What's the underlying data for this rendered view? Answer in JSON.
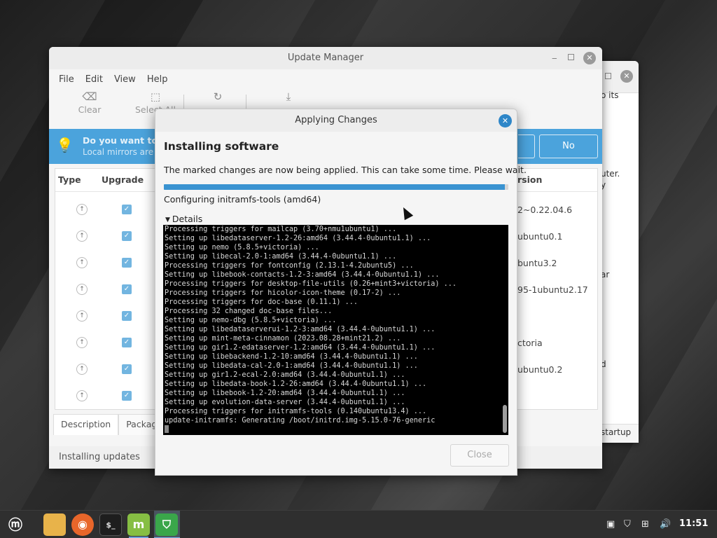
{
  "background_window": {
    "text_1": "o its",
    "text_2": "uter.",
    "text_3": "y",
    "text_4": "ar",
    "text_5": "d",
    "footer": "startup"
  },
  "update_manager": {
    "title": "Update Manager",
    "menu": [
      "File",
      "Edit",
      "View",
      "Help"
    ],
    "toolbar": {
      "clear": "Clear",
      "select_all": "Select All"
    },
    "infobar": {
      "title": "Do you want to s",
      "subtitle": "Local mirrors are",
      "no_label": "No"
    },
    "table": {
      "col_type": "Type",
      "col_upgrade": "Upgrade",
      "col_version": "rsion",
      "versions": [
        "2~0.22.04.6",
        "ubuntu0.1",
        "buntu3.2",
        "95-1ubuntu2.17",
        "",
        "ctoria",
        "ubuntu0.2",
        ""
      ]
    },
    "tabs": [
      "Description",
      "Packag"
    ],
    "status": "Installing updates"
  },
  "dialog": {
    "title": "Applying Changes",
    "heading": "Installing software",
    "message": "The marked changes are now being applied. This can take some time. Please wait.",
    "progress_fraction": 0.99,
    "status": "Configuring initramfs-tools (amd64)",
    "details_label": "Details",
    "close_label": "Close",
    "terminal_lines": [
      "Processing triggers for mailcap (3.70+nmu1ubuntu1) ...",
      "Setting up libedataserver-1.2-26:amd64 (3.44.4-0ubuntu1.1) ...",
      "Setting up nemo (5.8.5+victoria) ...",
      "Setting up libecal-2.0-1:amd64 (3.44.4-0ubuntu1.1) ...",
      "Processing triggers for fontconfig (2.13.1-4.2ubuntu5) ...",
      "Setting up libebook-contacts-1.2-3:amd64 (3.44.4-0ubuntu1.1) ...",
      "Processing triggers for desktop-file-utils (0.26+mint3+victoria) ...",
      "Processing triggers for hicolor-icon-theme (0.17-2) ...",
      "Processing triggers for doc-base (0.11.1) ...",
      "Processing 32 changed doc-base files...",
      "Setting up nemo-dbg (5.8.5+victoria) ...",
      "Setting up libedataserverui-1.2-3:amd64 (3.44.4-0ubuntu1.1) ...",
      "Setting up mint-meta-cinnamon (2023.08.28+mint21.2) ...",
      "Setting up gir1.2-edataserver-1.2:amd64 (3.44.4-0ubuntu1.1) ...",
      "Setting up libebackend-1.2-10:amd64 (3.44.4-0ubuntu1.1) ...",
      "Setting up libedata-cal-2.0-1:amd64 (3.44.4-0ubuntu1.1) ...",
      "Setting up gir1.2-ecal-2.0:amd64 (3.44.4-0ubuntu1.1) ...",
      "Setting up libedata-book-1.2-26:amd64 (3.44.4-0ubuntu1.1) ...",
      "Setting up libebook-1.2-20:amd64 (3.44.4-0ubuntu1.1) ...",
      "Setting up evolution-data-server (3.44.4-0ubuntu1.1) ...",
      "Processing triggers for initramfs-tools (0.140ubuntu13.4) ...",
      "update-initramfs: Generating /boot/initrd.img-5.15.0-76-generic"
    ]
  },
  "taskbar": {
    "clock": "11:51",
    "terminal_glyph": "$_",
    "icons": [
      "mint-menu-icon",
      "files-icon",
      "firefox-icon",
      "terminal-icon",
      "mintinstall-icon",
      "update-manager-icon"
    ]
  },
  "colors": {
    "accent": "#3a93d1",
    "infobar": "#4ba3dc",
    "dialog_close": "#2e86c8"
  }
}
